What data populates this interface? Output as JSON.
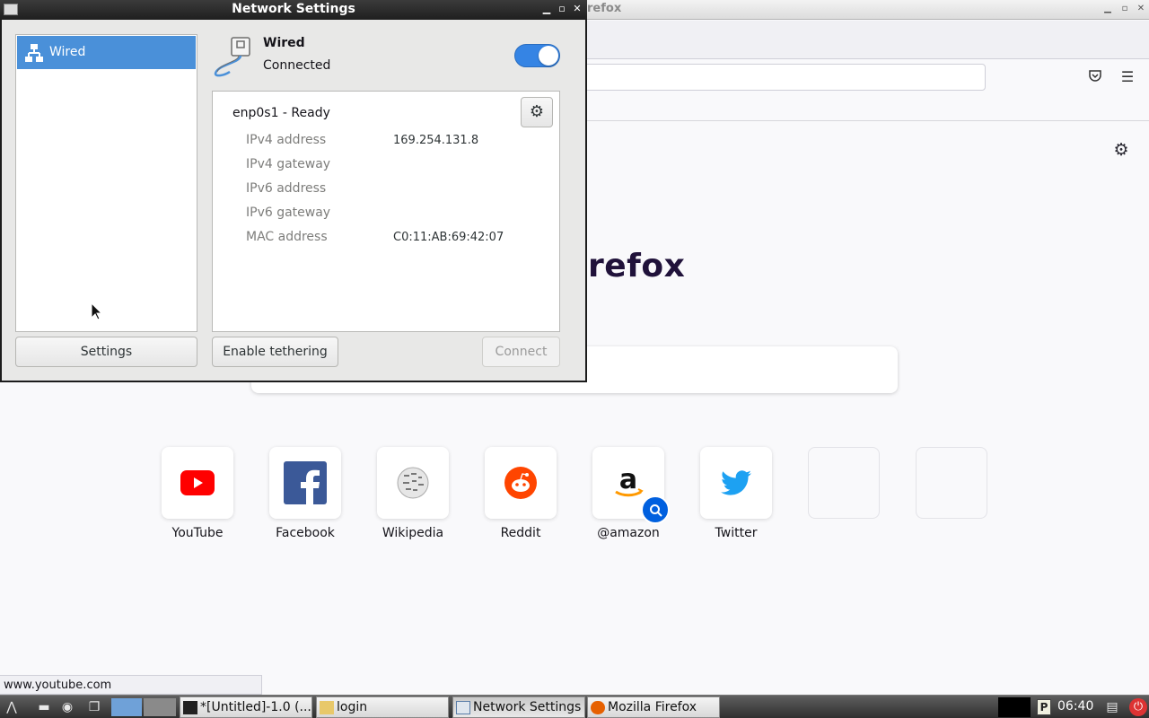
{
  "firefox": {
    "title": "Mozilla Firefox",
    "brand_text": "refox",
    "status_url": "www.youtube.com",
    "tiles": [
      {
        "label": "YouTube"
      },
      {
        "label": "Facebook"
      },
      {
        "label": "Wikipedia"
      },
      {
        "label": "Reddit"
      },
      {
        "label": "@amazon"
      },
      {
        "label": "Twitter"
      },
      {
        "label": ""
      },
      {
        "label": ""
      }
    ]
  },
  "network": {
    "window_title": "Network Settings",
    "sidebar": {
      "items": [
        {
          "label": "Wired",
          "icon": "wired-network-icon",
          "selected": true
        }
      ],
      "settings_button": "Settings"
    },
    "header": {
      "title": "Wired",
      "status": "Connected",
      "toggle_on": true
    },
    "device": {
      "title": "enp0s1 - Ready",
      "rows": [
        {
          "label": "IPv4 address",
          "value": "169.254.131.8"
        },
        {
          "label": "IPv4 gateway",
          "value": ""
        },
        {
          "label": "IPv6 address",
          "value": ""
        },
        {
          "label": "IPv6 gateway",
          "value": ""
        },
        {
          "label": "MAC address",
          "value": "C0:11:AB:69:42:07"
        }
      ]
    },
    "buttons": {
      "tethering": "Enable tethering",
      "connect": "Connect"
    }
  },
  "taskbar": {
    "tasks": [
      {
        "label": "*[Untitled]-1.0 (..."
      },
      {
        "label": "login"
      },
      {
        "label": "Network Settings"
      },
      {
        "label": "Mozilla Firefox"
      }
    ],
    "clock": "06:40",
    "tray_p": "P"
  },
  "colors": {
    "accent": "#4a90d9",
    "toggle": "#3584e4",
    "taskbar": "#3a3a3a"
  }
}
